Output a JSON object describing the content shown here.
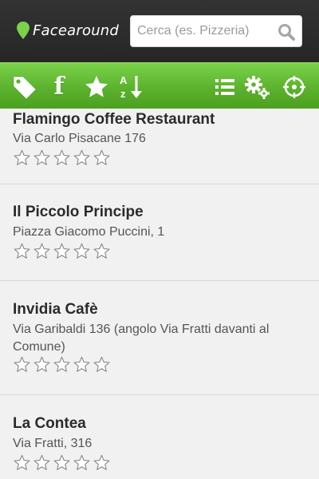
{
  "header": {
    "logo_text": "Facearound",
    "search_placeholder": "Cerca (es. Pizzeria)",
    "search_value": ""
  },
  "toolbar": {
    "icons": [
      "tag-icon",
      "facebook-icon",
      "star-icon",
      "sort-az-icon",
      "list-icon",
      "settings-icon",
      "locate-icon"
    ],
    "facebook_label": "f"
  },
  "places": [
    {
      "name": "Flamingo Coffee Restaurant",
      "address": "Via Carlo Pisacane 176",
      "rating": 0,
      "max_rating": 5
    },
    {
      "name": "Il Piccolo Principe",
      "address": "Piazza Giacomo Puccini, 1",
      "rating": 0,
      "max_rating": 5
    },
    {
      "name": "Invidia Cafè",
      "address": "Via Garibaldi 136 (angolo Via Fratti davanti al Comune)",
      "rating": 0,
      "max_rating": 5
    },
    {
      "name": "La Contea",
      "address": "Via  Fratti, 316",
      "rating": 0,
      "max_rating": 5
    }
  ],
  "colors": {
    "header_bg": "#2b2b2b",
    "toolbar_green": "#5cb22d",
    "logo_pin": "#7ad34a"
  }
}
